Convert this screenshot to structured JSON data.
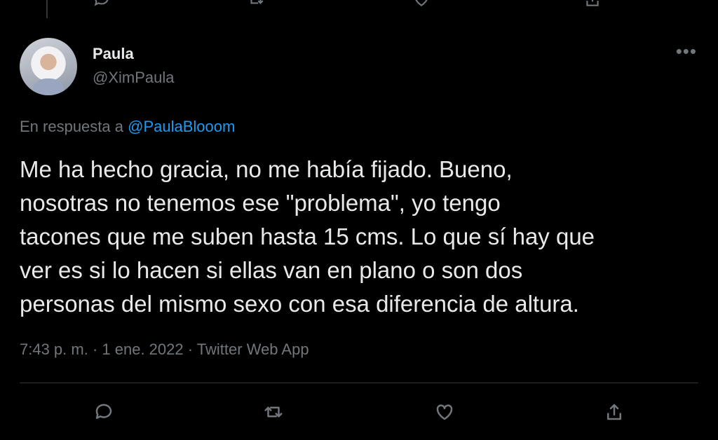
{
  "tweet": {
    "author": {
      "display_name": "Paula",
      "handle": "@XimPaula"
    },
    "reply_prefix": "En respuesta a",
    "reply_to": "@PaulaBlooom",
    "text": "Me ha hecho gracia, no me había fijado. Bueno,\nnosotras no tenemos ese \"problema\", yo tengo\ntacones que me suben hasta 15 cms. Lo que sí hay que\nver es si lo hacen si ellas van en plano o son dos\npersonas del mismo sexo con esa diferencia de altura.",
    "time": "7:43 p. m.",
    "date": "1 ene. 2022",
    "source": "Twitter Web App",
    "separator": " · ",
    "more_label": "•••"
  },
  "actions": {
    "reply_icon": "reply-icon",
    "retweet_icon": "retweet-icon",
    "like_icon": "like-icon",
    "share_icon": "share-icon"
  },
  "colors": {
    "background": "#000000",
    "text": "#e7e9ea",
    "muted": "#71767b",
    "accent": "#1d9bf0",
    "divider": "#2f3336"
  }
}
